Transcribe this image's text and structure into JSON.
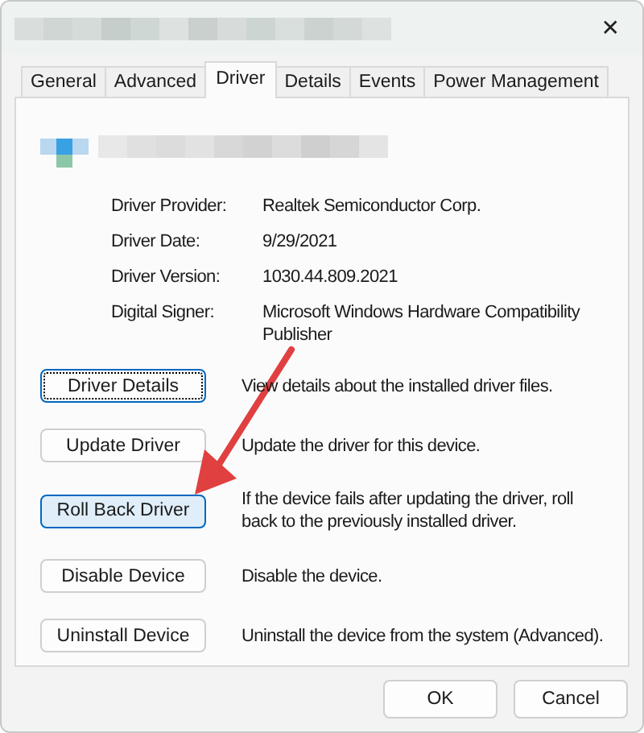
{
  "window": {
    "close": "✕"
  },
  "tabs": [
    {
      "label": "General",
      "selected": false
    },
    {
      "label": "Advanced",
      "selected": false
    },
    {
      "label": "Driver",
      "selected": true
    },
    {
      "label": "Details",
      "selected": false
    },
    {
      "label": "Events",
      "selected": false
    },
    {
      "label": "Power Management",
      "selected": false
    }
  ],
  "properties": [
    {
      "label": "Driver Provider:",
      "value": "Realtek Semiconductor Corp."
    },
    {
      "label": "Driver Date:",
      "value": "9/29/2021"
    },
    {
      "label": "Driver Version:",
      "value": "1030.44.809.2021"
    },
    {
      "label": "Digital Signer:",
      "value": "Microsoft Windows Hardware Compatibility Publisher"
    }
  ],
  "actions": [
    {
      "label": "Driver Details",
      "description": "View details about the installed driver files.",
      "focused": true,
      "highlighted": false
    },
    {
      "label": "Update Driver",
      "description": "Update the driver for this device.",
      "focused": false,
      "highlighted": false
    },
    {
      "label": "Roll Back Driver",
      "description": "If the device fails after updating the driver, roll back to the previously installed driver.",
      "focused": false,
      "highlighted": true
    },
    {
      "label": "Disable Device",
      "description": "Disable the device.",
      "focused": false,
      "highlighted": false
    },
    {
      "label": "Uninstall Device",
      "description": "Uninstall the device from the system (Advanced).",
      "focused": false,
      "highlighted": false
    }
  ],
  "footer": [
    "OK",
    "Cancel"
  ]
}
